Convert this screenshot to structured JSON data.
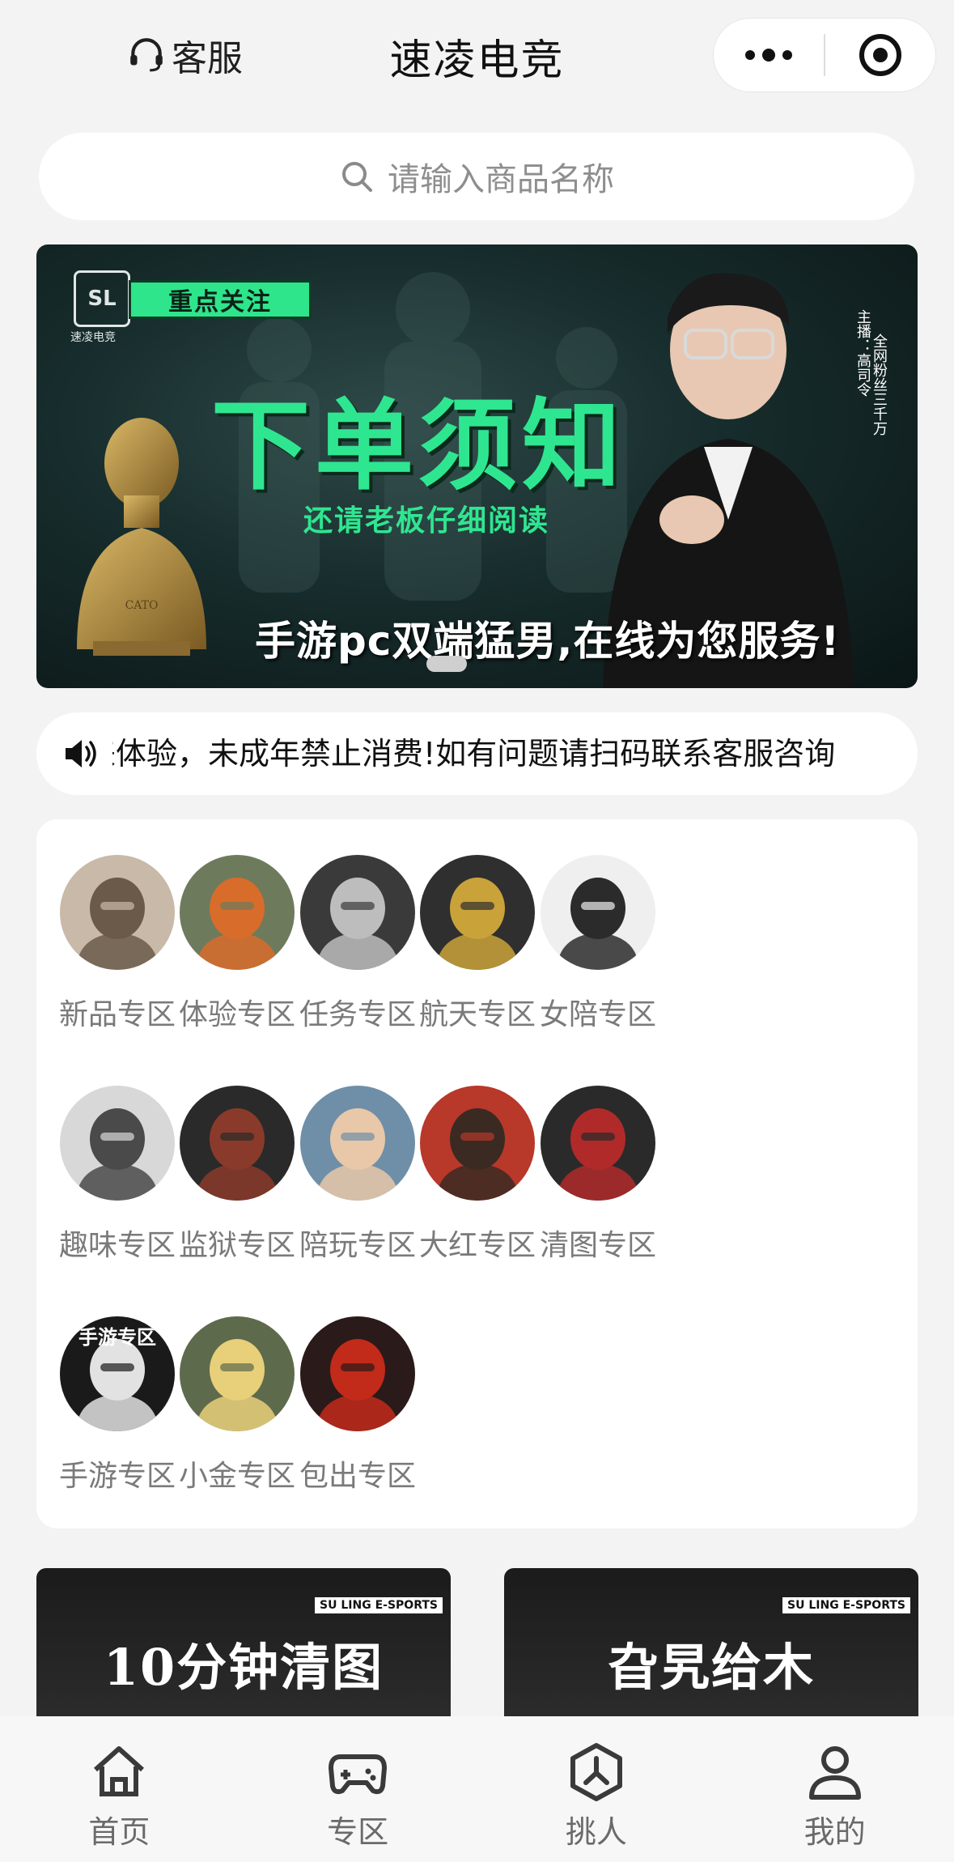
{
  "header": {
    "service_label": "客服",
    "title": "速凌电竞"
  },
  "search": {
    "placeholder": "请输入商品名称"
  },
  "banner": {
    "tag": "重点关注",
    "headline": "下单须知",
    "subheadline": "还请老板仔细阅读",
    "slogan": "手游pc双端猛男,在线为您服务!",
    "host_label": "主播：高司令",
    "fans_label": "全网粉丝三千万",
    "logo_text": "速凌电竞",
    "bust_inscription": "CATO"
  },
  "notice": {
    "text": "欢迎来体验，未成年禁止消费!如有问题请扫码联系客服咨询"
  },
  "categories": [
    {
      "label": "新品专区",
      "icon": "cowboy-hat-character-icon"
    },
    {
      "label": "体验专区",
      "icon": "goggles-soldier-icon"
    },
    {
      "label": "任务专区",
      "icon": "masked-operator-icon"
    },
    {
      "label": "航天专区",
      "icon": "gold-skull-icon"
    },
    {
      "label": "女陪专区",
      "icon": "chibi-girl-icon"
    },
    {
      "label": "趣味专区",
      "icon": "white-hair-girl-icon"
    },
    {
      "label": "监狱专区",
      "icon": "scarred-man-icon"
    },
    {
      "label": "陪玩专区",
      "icon": "chibi-soldier-icon"
    },
    {
      "label": "大红专区",
      "icon": "red-beret-icon"
    },
    {
      "label": "清图专区",
      "icon": "red-helmet-icon"
    },
    {
      "label": "手游专区",
      "icon": "mobile-game-girl-icon",
      "badge": "手游专区"
    },
    {
      "label": "小金专区",
      "icon": "blonde-soldier-icon"
    },
    {
      "label": "包出专区",
      "icon": "red-mask-icon"
    }
  ],
  "promos": [
    {
      "brand": "SU LING E-SPORTS",
      "title": "10分钟清图"
    },
    {
      "brand": "SU LING E-SPORTS",
      "title": "旮旯给木"
    }
  ],
  "tabbar": [
    {
      "label": "首页",
      "icon": "home-icon"
    },
    {
      "label": "专区",
      "icon": "gamepad-icon"
    },
    {
      "label": "挑人",
      "icon": "pick-person-icon"
    },
    {
      "label": "我的",
      "icon": "profile-icon"
    }
  ]
}
